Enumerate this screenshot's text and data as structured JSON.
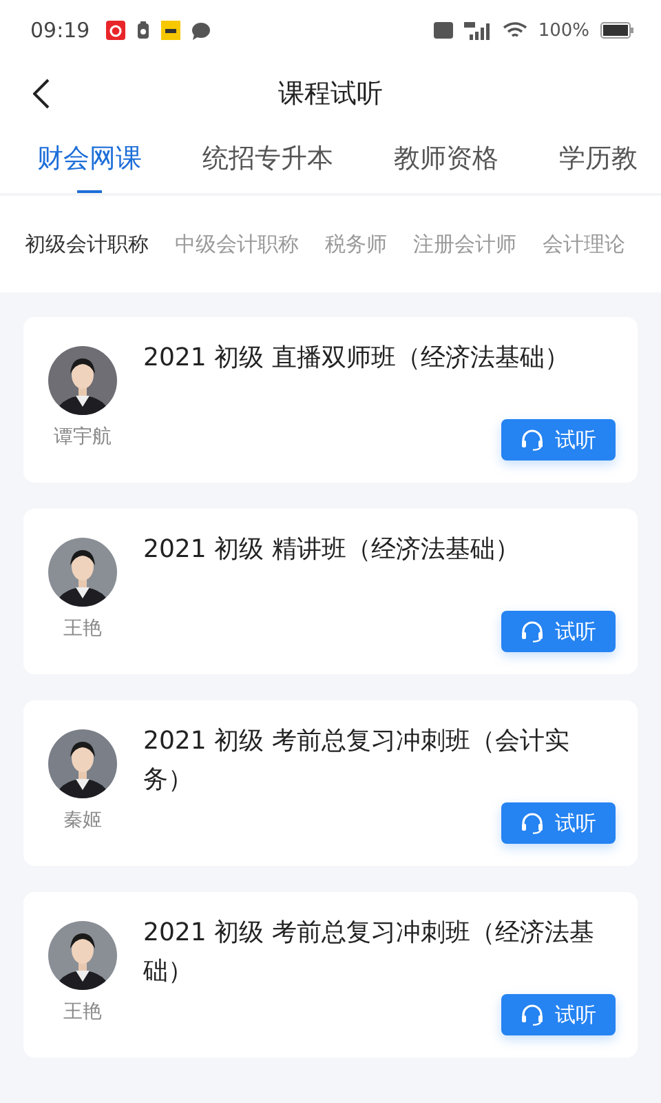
{
  "status_bar": {
    "time": "09:19",
    "battery": "100%"
  },
  "header": {
    "title": "课程试听"
  },
  "tabs": [
    {
      "label": "财会网课",
      "selected": true
    },
    {
      "label": "统招专升本",
      "selected": false
    },
    {
      "label": "教师资格",
      "selected": false
    },
    {
      "label": "学历教",
      "selected": false
    }
  ],
  "subtabs": [
    {
      "label": "初级会计职称",
      "selected": true
    },
    {
      "label": "中级会计职称",
      "selected": false
    },
    {
      "label": "税务师",
      "selected": false
    },
    {
      "label": "注册会计师",
      "selected": false
    },
    {
      "label": "会计理论",
      "selected": false
    }
  ],
  "courses": [
    {
      "title": "2021 初级 直播双师班（经济法基础）",
      "teacher": "谭宇航",
      "button": "试听"
    },
    {
      "title": "2021 初级 精讲班（经济法基础）",
      "teacher": "王艳",
      "button": "试听"
    },
    {
      "title": "2021 初级 考前总复习冲刺班（会计实务）",
      "teacher": "秦姬",
      "button": "试听"
    },
    {
      "title": "2021 初级 考前总复习冲刺班（经济法基础）",
      "teacher": "王艳",
      "button": "试听"
    }
  ]
}
